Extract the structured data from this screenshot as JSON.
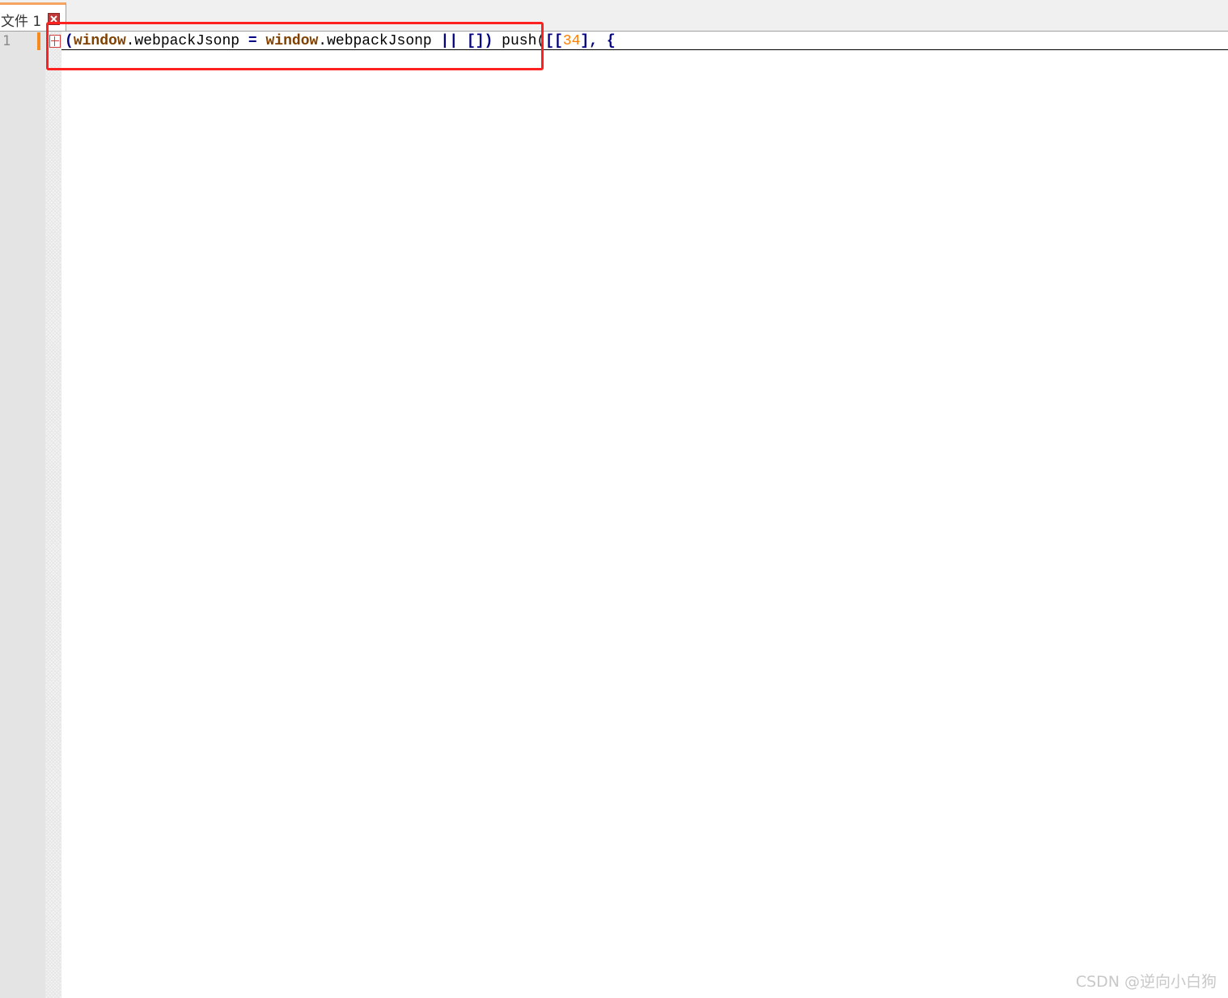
{
  "tab": {
    "label": "文件 1"
  },
  "editor": {
    "line_number": "1",
    "code_tokens": {
      "t1": "(",
      "t2": "window",
      "t3": ".webpackJsonp ",
      "t4": "=",
      "t5": " ",
      "t6": "window",
      "t7": ".webpackJsonp ",
      "t8": "||",
      "t9": " ",
      "t10": "[])",
      "t11": " push(",
      "t12": "[[",
      "t13": "34",
      "t14": "],",
      "t15": " ",
      "t16": "{"
    }
  },
  "watermark": "CSDN @逆向小白狗",
  "colors": {
    "keyword": "#804000",
    "operator": "#000080",
    "number": "#ff8000",
    "highlight_box": "#ff2020",
    "change_bar": "#f58b1f"
  },
  "icons": {
    "tab_close": "close-icon",
    "fold": "fold-plus-icon"
  }
}
